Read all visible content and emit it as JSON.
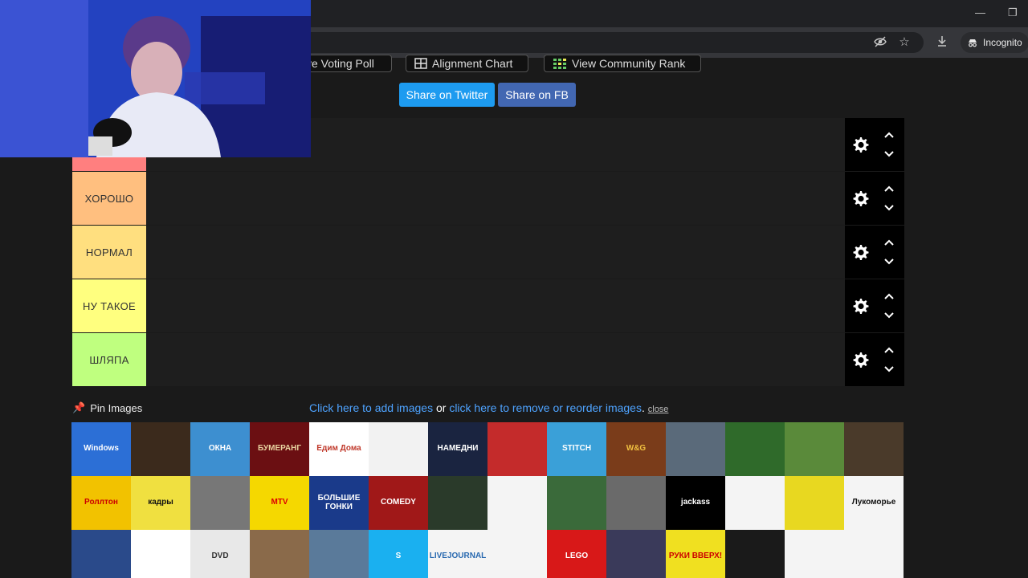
{
  "browser": {
    "incognito_label": "Incognito",
    "window_controls": [
      "—",
      "❐"
    ]
  },
  "page": {
    "top_buttons": [
      {
        "label": "ve Voting Poll"
      },
      {
        "label": "Alignment Chart"
      },
      {
        "label": "View Community Rank"
      }
    ],
    "share_twitter": "Share on Twitter",
    "share_fb": "Share on FB",
    "tiers": [
      {
        "label": "",
        "color": "#ff7f7f"
      },
      {
        "label": "ХОРОШО",
        "color": "#ffbf7f"
      },
      {
        "label": "НОРМАЛ",
        "color": "#ffdf7f"
      },
      {
        "label": "НУ ТАКОЕ",
        "color": "#ffff7f"
      },
      {
        "label": "ШЛЯПА",
        "color": "#bfff7f"
      }
    ],
    "pin_label": "Pin Images",
    "add_images_link": "Click here to add images",
    "or_text": " or ",
    "reorder_link": "click here to remove or reorder images",
    "period": ". ",
    "close_link": "close"
  },
  "tiles": [
    {
      "text": "Windows",
      "bg": "#2c6fd6",
      "fg": "#fff"
    },
    {
      "text": "",
      "bg": "#3b2a1c",
      "fg": "#e6c27a"
    },
    {
      "text": "ОКНА",
      "bg": "#3d8fd0",
      "fg": "#fff"
    },
    {
      "text": "БУМЕРАНГ",
      "bg": "#6b0f12",
      "fg": "#e8d2a0"
    },
    {
      "text": "Едим Дома",
      "bg": "#ffffff",
      "fg": "#c0392b"
    },
    {
      "text": "",
      "bg": "#f2f2f2",
      "fg": "#333"
    },
    {
      "text": "НАМЕДНИ",
      "bg": "#1a2440",
      "fg": "#fff"
    },
    {
      "text": "",
      "bg": "#c42b2b",
      "fg": "#fff"
    },
    {
      "text": "STITCH",
      "bg": "#3aa0d8",
      "fg": "#fff"
    },
    {
      "text": "W&G",
      "bg": "#7a3c1a",
      "fg": "#f0c040"
    },
    {
      "text": "",
      "bg": "#5a6a7a",
      "fg": "#fff"
    },
    {
      "text": "",
      "bg": "#2f6a2a",
      "fg": "#fff"
    },
    {
      "text": "",
      "bg": "#5a8a3a",
      "fg": "#fff"
    },
    {
      "text": "",
      "bg": "#4a3a2a",
      "fg": "#fff"
    },
    {
      "text": "Роллтон",
      "bg": "#f2c200",
      "fg": "#c00"
    },
    {
      "text": "кадры",
      "bg": "#f0e040",
      "fg": "#111"
    },
    {
      "text": "",
      "bg": "#777",
      "fg": "#fff"
    },
    {
      "text": "MTV",
      "bg": "#f5d800",
      "fg": "#d00"
    },
    {
      "text": "БОЛЬШИЕ ГОНКИ",
      "bg": "#1a3a8a",
      "fg": "#fff"
    },
    {
      "text": "COMEDY",
      "bg": "#a01818",
      "fg": "#fff"
    },
    {
      "text": "",
      "bg": "#2a3a2a",
      "fg": "#fff"
    },
    {
      "text": "",
      "bg": "#f4f4f4",
      "fg": "#3a8a3a"
    },
    {
      "text": "",
      "bg": "#3a6a3a",
      "fg": "#fff"
    },
    {
      "text": "",
      "bg": "#6a6a6a",
      "fg": "#fff"
    },
    {
      "text": "jackass",
      "bg": "#000",
      "fg": "#fff"
    },
    {
      "text": "",
      "bg": "#f4f4f4",
      "fg": "#c00"
    },
    {
      "text": "",
      "bg": "#e8d820",
      "fg": "#333"
    },
    {
      "text": "Лукоморье",
      "bg": "#f4f4f4",
      "fg": "#111"
    },
    {
      "text": "",
      "bg": "#2a4a8a",
      "fg": "#fff"
    },
    {
      "text": "",
      "bg": "#ffffff",
      "fg": "#3a9a2a"
    },
    {
      "text": "DVD",
      "bg": "#e8e8e8",
      "fg": "#333"
    },
    {
      "text": "",
      "bg": "#8a6a4a",
      "fg": "#fff"
    },
    {
      "text": "",
      "bg": "#5a7a9a",
      "fg": "#fff"
    },
    {
      "text": "S",
      "bg": "#1ab0f0",
      "fg": "#fff"
    },
    {
      "text": "LIVEJOURNAL",
      "bg": "#f4f4f4",
      "fg": "#2a6ab0"
    },
    {
      "text": "",
      "bg": "#f4f4f4",
      "fg": "#f0c020"
    },
    {
      "text": "LEGO",
      "bg": "#d81818",
      "fg": "#fff"
    },
    {
      "text": "",
      "bg": "#3a3a5a",
      "fg": "#fff"
    },
    {
      "text": "РУКИ ВВЕРХ!",
      "bg": "#f0e020",
      "fg": "#c00"
    },
    {
      "text": "",
      "bg": "#1a1a1a",
      "fg": "#fff"
    },
    {
      "text": "",
      "bg": "#f4f4f4",
      "fg": "#333"
    },
    {
      "text": "",
      "bg": "#f4f4f4",
      "fg": "#111"
    }
  ]
}
